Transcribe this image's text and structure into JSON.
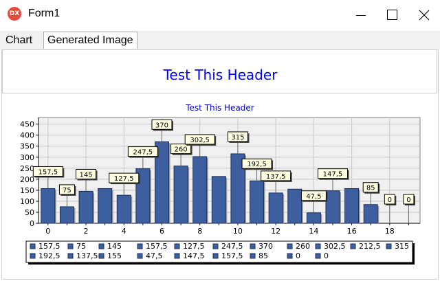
{
  "window": {
    "title": "Form1",
    "icon": "dx-app-icon"
  },
  "tabs": [
    {
      "label": "Chart"
    },
    {
      "label": "Generated Image"
    }
  ],
  "header": {
    "text": "Test This Header"
  },
  "chart_data": {
    "type": "bar",
    "title": "Test This Header",
    "x": [
      0,
      1,
      2,
      3,
      4,
      5,
      6,
      7,
      8,
      9,
      10,
      11,
      12,
      13,
      14,
      15,
      16,
      17,
      18,
      19
    ],
    "values": [
      157.5,
      75,
      145,
      157.5,
      127.5,
      247.5,
      370,
      260,
      302.5,
      212.5,
      315,
      192.5,
      137.5,
      155,
      47.5,
      147.5,
      157.5,
      85,
      0,
      0
    ],
    "labels": [
      "157,5",
      "75",
      "145",
      "157,5",
      "127,5",
      "247,5",
      "370",
      "260",
      "302,5",
      "212,5",
      "315",
      "192,5",
      "137,5",
      "155",
      "47,5",
      "147,5",
      "157,5",
      "85",
      "0",
      "0"
    ],
    "shown_labels": [
      0,
      1,
      2,
      4,
      5,
      6,
      7,
      8,
      10,
      11,
      12,
      14,
      15,
      17,
      18,
      19
    ],
    "xticks": [
      0,
      2,
      4,
      6,
      8,
      10,
      12,
      14,
      16,
      18
    ],
    "yticks": [
      0,
      50,
      100,
      150,
      200,
      250,
      300,
      350,
      400,
      450
    ],
    "ylim": [
      0,
      480
    ],
    "xlim": [
      -0.5,
      19.6
    ],
    "grid": true,
    "bar_color": "#3d5fa0",
    "legend_placement": "bottom-left",
    "legend": [
      "157,5",
      "75",
      "145",
      "157,5",
      "127,5",
      "247,5",
      "370",
      "260",
      "302,5",
      "212,5",
      "315",
      "192,5",
      "137,5",
      "155",
      "47,5",
      "147,5",
      "157,5",
      "85",
      "0",
      "0"
    ]
  }
}
